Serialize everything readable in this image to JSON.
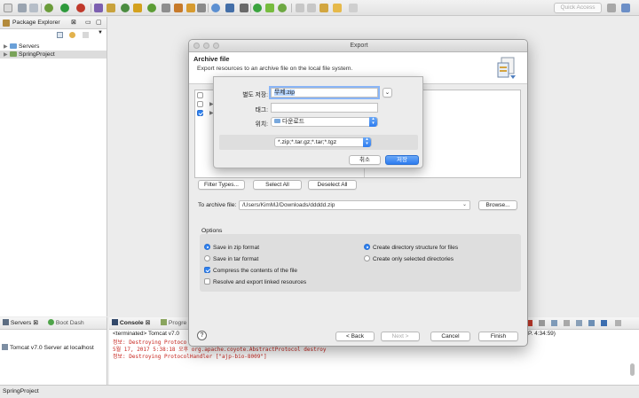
{
  "toolbar": {
    "quick_access": "Quick Access"
  },
  "package_explorer": {
    "tab_label": "Package Explorer",
    "items": [
      {
        "label": "Servers"
      },
      {
        "label": "SpringProject"
      }
    ]
  },
  "servers_panel": {
    "tabs": [
      "Servers",
      "Boot Dash"
    ],
    "items": [
      {
        "label": "Tomcat v7.0 Server at localhost"
      }
    ]
  },
  "console_panel": {
    "tabs": [
      "Console",
      "Progre"
    ],
    "terminated": "<terminated> Tomcat v7.0",
    "time": "P. 4:34:59)",
    "lines": [
      "정보: Destroying Protoco",
      "5월 17, 2017 5:38:18 오후 org.apache.coyote.AbstractProtocol destroy",
      "정보: Destroying ProtocolHandler [\"ajp-bio-8009\"]"
    ]
  },
  "statusbar": {
    "selection": "SpringProject"
  },
  "export_dialog": {
    "window_title": "Export",
    "heading": "Archive file",
    "description": "Export resources to an archive file on the local file system.",
    "buttons": {
      "filter_types": "Filter Types...",
      "select_all": "Select All",
      "deselect_all": "Deselect All",
      "browse": "Browse...",
      "back": "< Back",
      "next": "Next >",
      "cancel": "Cancel",
      "finish": "Finish"
    },
    "to_archive_label": "To archive file:",
    "to_archive_value": "/Users/KimMJ/Downloads/ddddd.zip",
    "options_title": "Options",
    "options": {
      "zip_format": {
        "label": "Save in zip format",
        "selected": true
      },
      "tar_format": {
        "label": "Save in tar format",
        "selected": false
      },
      "compress": {
        "label": "Compress the contents of the file",
        "checked": true
      },
      "resolve_links": {
        "label": "Resolve and export linked resources",
        "checked": false
      },
      "dir_structure": {
        "label": "Create directory structure for files",
        "selected": true
      },
      "selected_dirs": {
        "label": "Create only selected directories",
        "selected": false
      }
    },
    "help_glyph": "?"
  },
  "save_sheet": {
    "save_as_label": "별도 저장:",
    "filename": "무제.zip",
    "tags_label": "태그:",
    "tags_value": "",
    "location_label": "위치:",
    "location_value": "다운로드",
    "format_value": "*.zip;*.tar.gz;*.tar;*.tgz",
    "cancel_label": "취소",
    "save_label": "저장"
  }
}
